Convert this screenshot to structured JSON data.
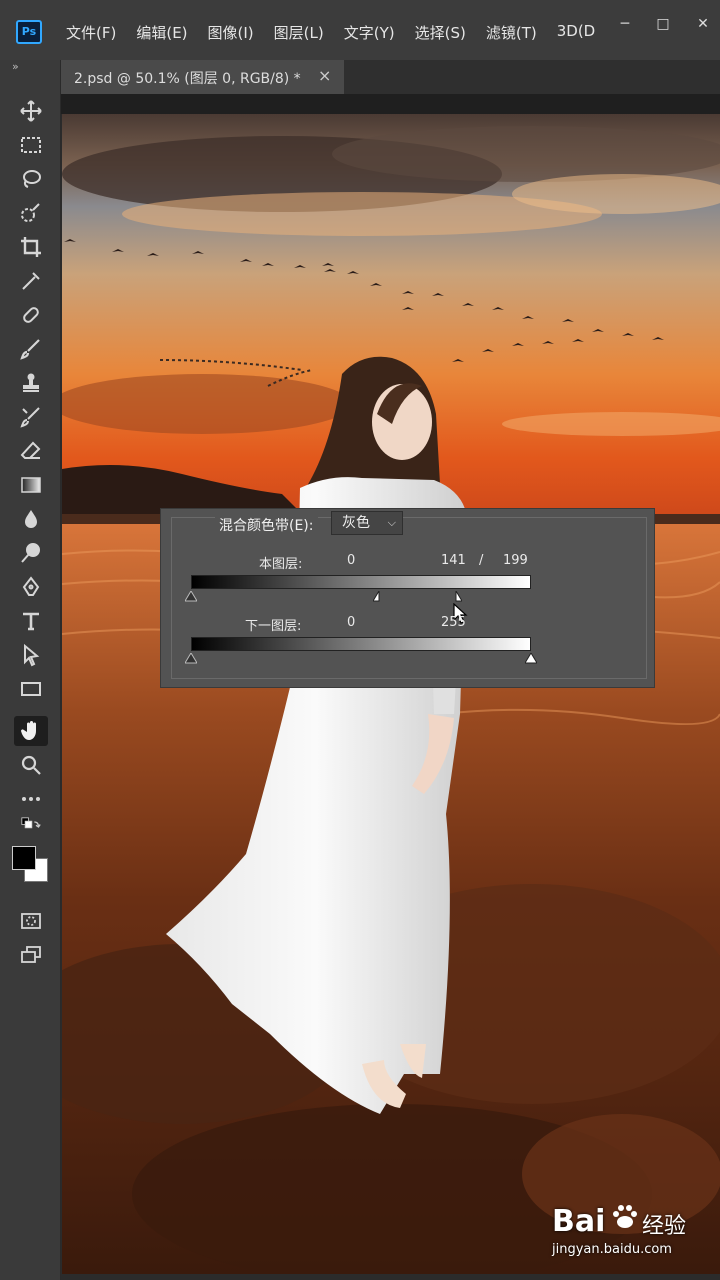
{
  "app": {
    "logo_text": "Ps"
  },
  "menu": [
    "文件(F)",
    "编辑(E)",
    "图像(I)",
    "图层(L)",
    "文字(Y)",
    "选择(S)",
    "滤镜(T)",
    "3D(D"
  ],
  "window_controls": {
    "minimize": "─",
    "maximize": "□",
    "close": "✕"
  },
  "toolbar": {
    "collapse_glyph": "»"
  },
  "document_tab": {
    "label": "2.psd @ 50.1% (图层 0, RGB/8) *",
    "close_glyph": "×"
  },
  "tools": [
    "move-icon",
    "marquee-icon",
    "lasso-icon",
    "quick-select-icon",
    "crop-icon",
    "eyedropper-icon",
    "healing-brush-icon",
    "brush-icon",
    "clone-stamp-icon",
    "history-brush-icon",
    "eraser-icon",
    "gradient-icon",
    "blur-icon",
    "dodge-icon",
    "pen-icon",
    "type-icon",
    "path-select-icon",
    "rectangle-icon",
    "hand-icon",
    "zoom-icon",
    "more-tools-icon"
  ],
  "colors": {
    "foreground": "#000000",
    "background": "#ffffff",
    "ui_accent": "#31a8ff"
  },
  "blend_if": {
    "title": "混合颜色带(E):",
    "channel": "灰色",
    "this_layer": {
      "label": "本图层:",
      "black_value": "0",
      "white_low": "141",
      "separator": "/",
      "white_high": "199",
      "black_handle": 0,
      "white_split_low": 141,
      "white_split_high": 199
    },
    "underlying_layer": {
      "label": "下一图层:",
      "black_value": "0",
      "white_value": "255",
      "black_handle": 0,
      "white_handle": 255
    }
  },
  "watermark": {
    "brand": "Bai",
    "brand_cn": "经验",
    "url": "jingyan.baidu.com"
  }
}
